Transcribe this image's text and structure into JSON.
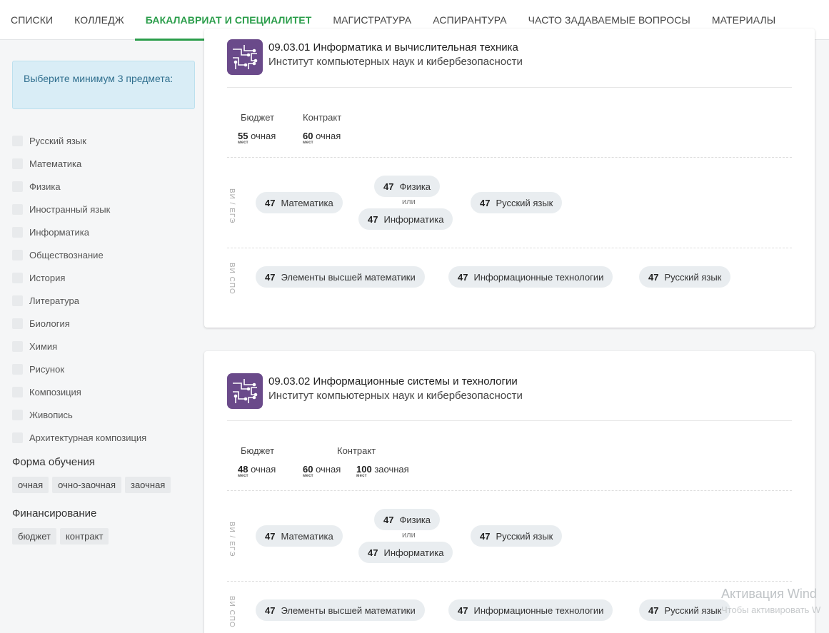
{
  "nav": {
    "tabs": [
      {
        "label": "СПИСКИ"
      },
      {
        "label": "КОЛЛЕДЖ"
      },
      {
        "label": "БАКАЛАВРИАТ И СПЕЦИАЛИТЕТ"
      },
      {
        "label": "МАГИСТРАТУРА"
      },
      {
        "label": "АСПИРАНТУРА"
      },
      {
        "label": "ЧАСТО ЗАДАВАЕМЫЕ ВОПРОСЫ"
      },
      {
        "label": "МАТЕРИАЛЫ"
      }
    ],
    "active": "БАКАЛАВРИАТ И СПЕЦИАЛИТЕТ",
    "accent": "#2a9d4a"
  },
  "sidebar": {
    "hint": "Выберите минимум 3 предмета:",
    "subjects": [
      "Русский язык",
      "Математика",
      "Физика",
      "Иностранный язык",
      "Информатика",
      "Обществознание",
      "История",
      "Литература",
      "Биология",
      "Химия",
      "Рисунок",
      "Композиция",
      "Живопись",
      "Архитектурная композиция"
    ],
    "form_title": "Форма обучения",
    "forms": [
      "очная",
      "очно-заочная",
      "заочная"
    ],
    "fin_title": "Финансирование",
    "fin": [
      "бюджет",
      "контракт"
    ]
  },
  "cards": [
    {
      "code_title": "09.03.01 Информатика и вычислительная техника",
      "institute": "Институт компьютерных наук и кибербезопасности",
      "budget_label": "Бюджет",
      "contract_label": "Контракт",
      "budget": {
        "num": "55",
        "form": "очная",
        "unit": "мест"
      },
      "contract": [
        {
          "num": "60",
          "form": "очная",
          "unit": "мест"
        }
      ],
      "ege_label": "ВИ / ЕГЭ",
      "ege": {
        "m": {
          "score": "47",
          "name": "Математика"
        },
        "alt1": {
          "score": "47",
          "name": "Физика"
        },
        "or": "или",
        "alt2": {
          "score": "47",
          "name": "Информатика"
        },
        "r": {
          "score": "47",
          "name": "Русский язык"
        }
      },
      "spo_label": "ВИ СПО",
      "spo": [
        {
          "score": "47",
          "name": "Элементы высшей математики"
        },
        {
          "score": "47",
          "name": "Информационные технологии"
        },
        {
          "score": "47",
          "name": "Русский язык"
        }
      ]
    },
    {
      "code_title": "09.03.02 Информационные системы и технологии",
      "institute": "Институт компьютерных наук и кибербезопасности",
      "budget_label": "Бюджет",
      "contract_label": "Контракт",
      "budget": {
        "num": "48",
        "form": "очная",
        "unit": "мест"
      },
      "contract": [
        {
          "num": "60",
          "form": "очная",
          "unit": "мест"
        },
        {
          "num": "100",
          "form": "заочная",
          "unit": "мест"
        }
      ],
      "ege_label": "ВИ / ЕГЭ",
      "ege": {
        "m": {
          "score": "47",
          "name": "Математика"
        },
        "alt1": {
          "score": "47",
          "name": "Физика"
        },
        "or": "или",
        "alt2": {
          "score": "47",
          "name": "Информатика"
        },
        "r": {
          "score": "47",
          "name": "Русский язык"
        }
      },
      "spo_label": "ВИ СПО",
      "spo": [
        {
          "score": "47",
          "name": "Элементы высшей математики"
        },
        {
          "score": "47",
          "name": "Информационные технологии"
        },
        {
          "score": "47",
          "name": "Русский язык"
        }
      ]
    }
  ],
  "watermark": {
    "line1": "Активация Wind",
    "line2": "Чтобы активировать W"
  }
}
